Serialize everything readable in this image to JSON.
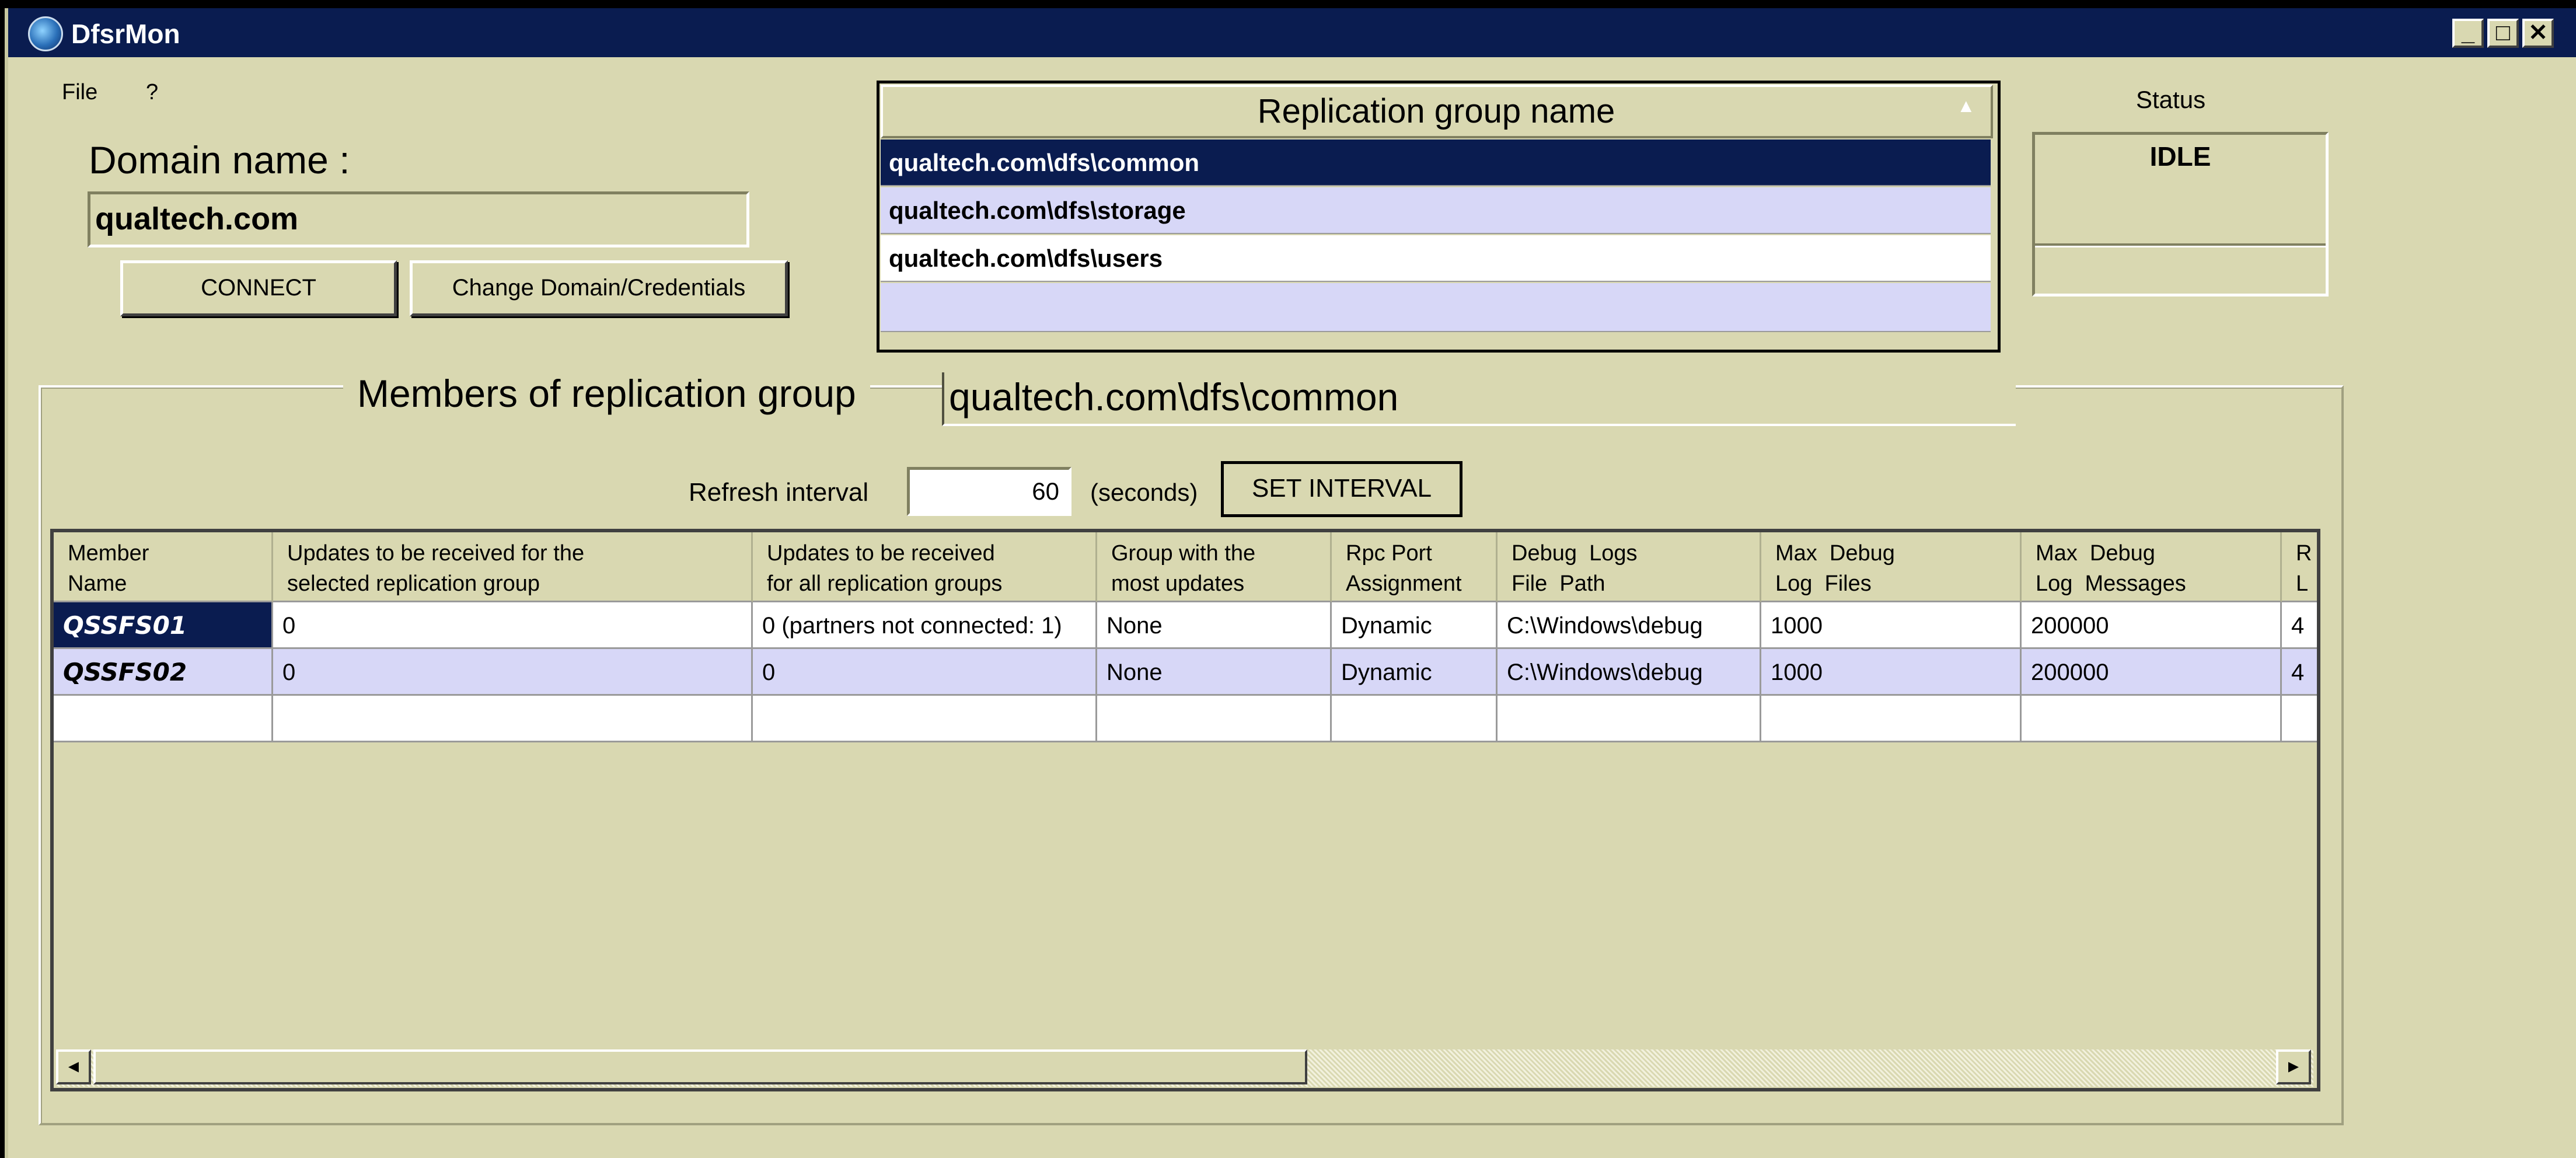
{
  "window": {
    "title": "DfsrMon",
    "controls": {
      "minimize": "_",
      "maximize": "□",
      "close": "✕"
    }
  },
  "menu": [
    "File",
    "?"
  ],
  "domain": {
    "label": "Domain name :",
    "value": "qualtech.com",
    "connect_label": "CONNECT",
    "change_label": "Change Domain/Credentials"
  },
  "replication_groups": {
    "header": "Replication group name",
    "sort_indicator": "▲",
    "rows": [
      "qualtech.com\\dfs\\common",
      "qualtech.com\\dfs\\storage",
      "qualtech.com\\dfs\\users"
    ],
    "selected_index": 0
  },
  "status": {
    "label": "Status",
    "value": "IDLE"
  },
  "members": {
    "group_label": "Members of replication group",
    "group_value": "qualtech.com\\dfs\\common",
    "refresh_label": "Refresh interval",
    "refresh_value": "60",
    "refresh_unit": "(seconds)",
    "set_interval_label": "SET INTERVAL",
    "columns": [
      "Member\nName",
      "Updates to be received for the\nselected replication group",
      "Updates to be received\nfor all replication groups",
      "Group with the\nmost updates",
      "Rpc Port\nAssignment",
      "Debug  Logs\nFile  Path",
      "Max  Debug\nLog  Files",
      "Max  Debug\nLog  Messages",
      "R\nL"
    ],
    "rows": [
      [
        "QSSFS01",
        "0",
        "0 (partners not connected: 1)",
        "None",
        "Dynamic",
        "C:\\Windows\\debug",
        "1000",
        "200000",
        "4"
      ],
      [
        "QSSFS02",
        "0",
        "0",
        "None",
        "Dynamic",
        "C:\\Windows\\debug",
        "1000",
        "200000",
        "4"
      ]
    ]
  },
  "scrollbar": {
    "left_arrow": "◄",
    "right_arrow": "►"
  },
  "colors": {
    "face": "#d9d8b1",
    "titlebar": "#0a1c50",
    "selection": "#0a1c50",
    "alt_row": "#d7d7f7"
  }
}
